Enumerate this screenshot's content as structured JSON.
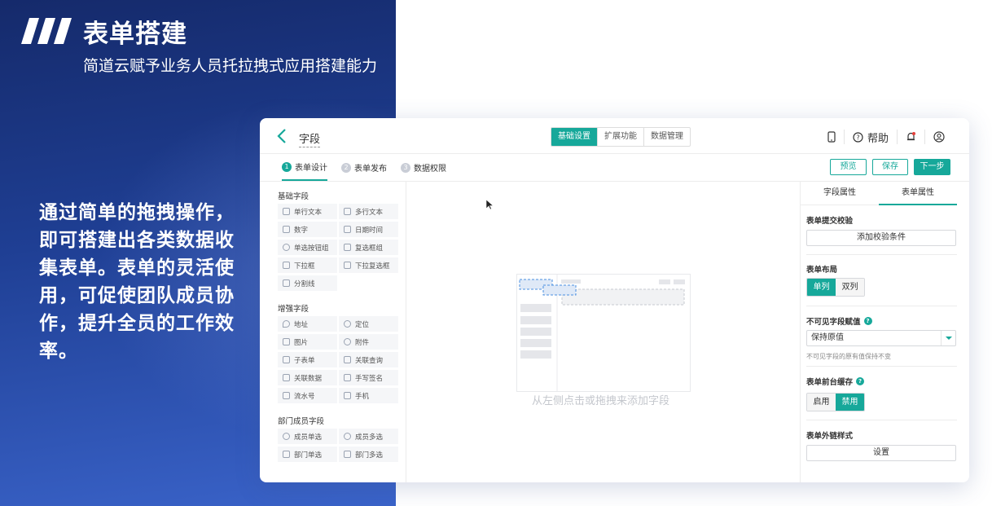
{
  "hero": {
    "title": "表单搭建",
    "subtitle": "简道云赋予业务人员托拉拽式应用搭建能力",
    "body": "通过简单的拖拽操作，即可搭建出各类数据收集表单。表单的灵活使用，可促使团队成员协作，提升全员的工作效率。"
  },
  "app": {
    "form_name": "字段",
    "top_tabs": [
      {
        "label": "基础设置",
        "active": true
      },
      {
        "label": "扩展功能",
        "active": false
      },
      {
        "label": "数据管理",
        "active": false
      }
    ],
    "help_label": "帮助",
    "steps": [
      {
        "num": "1",
        "label": "表单设计",
        "active": true
      },
      {
        "num": "2",
        "label": "表单发布",
        "active": false
      },
      {
        "num": "3",
        "label": "数据权限",
        "active": false
      }
    ],
    "preview_label": "预览",
    "save_label": "保存",
    "next_label": "下一步",
    "groups": [
      {
        "title": "基础字段",
        "fields": [
          "单行文本",
          "多行文本",
          "数字",
          "日期时间",
          "单选按钮组",
          "复选框组",
          "下拉框",
          "下拉复选框",
          "分割线"
        ]
      },
      {
        "title": "增强字段",
        "fields": [
          "地址",
          "定位",
          "图片",
          "附件",
          "子表单",
          "关联查询",
          "关联数据",
          "手写签名",
          "流水号",
          "手机"
        ]
      },
      {
        "title": "部门成员字段",
        "fields": [
          "成员单选",
          "成员多选",
          "部门单选",
          "部门多选"
        ]
      }
    ],
    "canvas_hint": "从左侧点击或拖拽来添加字段",
    "right_tabs": [
      {
        "label": "字段属性",
        "active": false
      },
      {
        "label": "表单属性",
        "active": true
      }
    ],
    "validation": {
      "title": "表单提交校验",
      "button": "添加校验条件"
    },
    "layout": {
      "title": "表单布局",
      "options": [
        {
          "label": "单列",
          "active": true
        },
        {
          "label": "双列",
          "active": false
        }
      ]
    },
    "invisible": {
      "title": "不可见字段赋值",
      "value": "保持原值",
      "desc": "不可见字段的原有值保持不变"
    },
    "cache": {
      "title": "表单前台缓存",
      "options": [
        {
          "label": "启用",
          "active": false
        },
        {
          "label": "禁用",
          "active": true
        }
      ]
    },
    "link_style": {
      "title": "表单外链样式",
      "button": "设置"
    },
    "colors": {
      "accent": "#16a89a",
      "hero_dark": "#152a6b",
      "hero_light": "#3a63c9"
    }
  }
}
